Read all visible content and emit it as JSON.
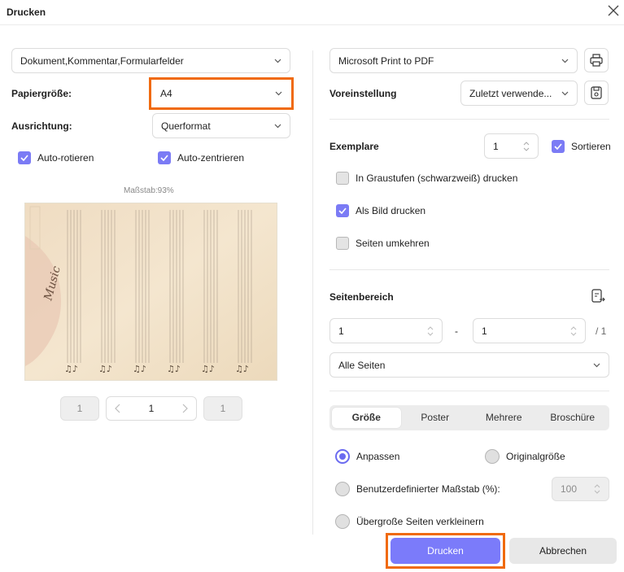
{
  "dialog": {
    "title": "Drucken"
  },
  "left": {
    "content_select": "Dokument,Kommentar,Formularfelder",
    "paper_size_label": "Papiergröße:",
    "paper_size_value": "A4",
    "orientation_label": "Ausrichtung:",
    "orientation_value": "Querformat",
    "auto_rotate": "Auto-rotieren",
    "auto_center": "Auto-zentrieren",
    "scale_text": "Maßstab:93%",
    "preview_image_text": "Music",
    "pager": {
      "first": "1",
      "current": "1",
      "last": "1",
      "prev_icon": "chevron-left-icon",
      "next_icon": "chevron-right-icon"
    }
  },
  "right": {
    "printer": "Microsoft Print to PDF",
    "preset_label": "Voreinstellung",
    "preset_value": "Zuletzt verwende...",
    "copies_label": "Exemplare",
    "copies_value": "1",
    "sort_label": "Sortieren",
    "grayscale": "In Graustufen (schwarzweiß) drucken",
    "as_image": "Als Bild drucken",
    "reverse_pages": "Seiten umkehren",
    "page_range_label": "Seitenbereich",
    "range_from": "1",
    "range_dash": "-",
    "range_to": "1",
    "range_total": "/ 1",
    "range_select": "Alle Seiten",
    "tabs": [
      "Größe",
      "Poster",
      "Mehrere",
      "Broschüre"
    ],
    "fit": "Anpassen",
    "original_size": "Originalgröße",
    "custom_scale": "Benutzerdefinierter Maßstab (%):",
    "custom_scale_value": "100",
    "shrink_oversized": "Übergroße Seiten verkleinern"
  },
  "footer": {
    "print_button": "Drucken",
    "cancel_button": "Abbrechen"
  },
  "colors": {
    "accent": "#7b7bf5",
    "highlight": "#f06a0e",
    "primary_button": "#7b7bfa"
  }
}
